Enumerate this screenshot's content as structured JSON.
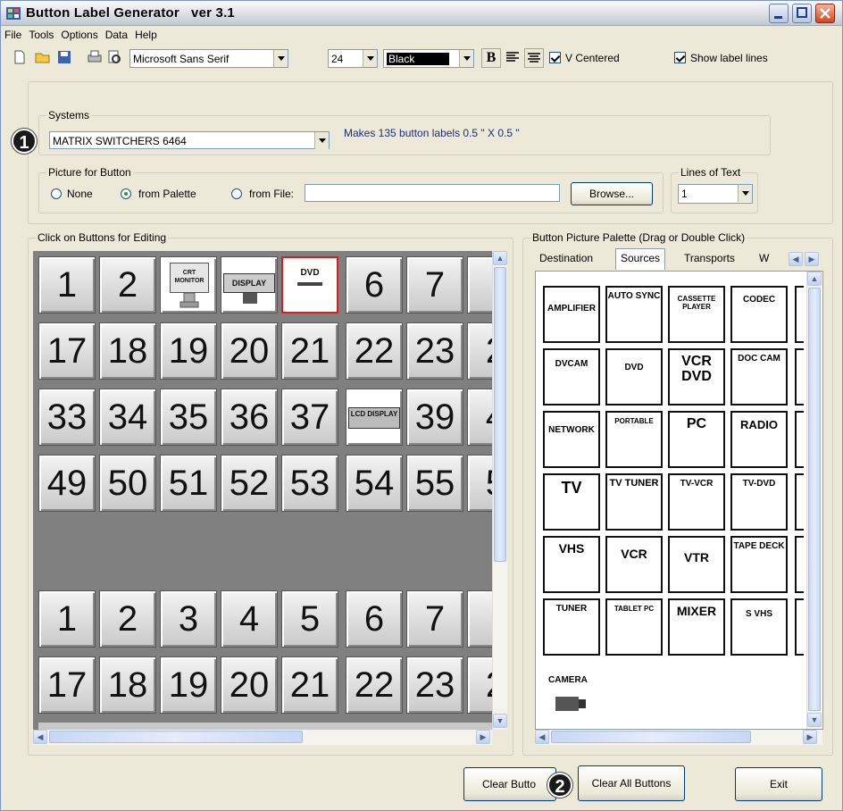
{
  "window": {
    "title": "Button Label Generator",
    "version": "ver 3.1"
  },
  "menu": [
    "File",
    "Tools",
    "Options",
    "Data",
    "Help"
  ],
  "toolbar": {
    "font": "Microsoft Sans Serif",
    "size": "24",
    "color": "Black",
    "bold": "B",
    "v_centered": "V Centered",
    "show_label_lines": "Show label lines"
  },
  "systems": {
    "label": "Systems",
    "value": "MATRIX SWITCHERS 6464",
    "info": "Makes 135 button labels 0.5 \" X 0.5 \""
  },
  "picture": {
    "label": "Picture for Button",
    "none": "None",
    "palette": "from Palette",
    "file": "from File:",
    "browse": "Browse..."
  },
  "lines": {
    "label": "Lines of Text",
    "value": "1"
  },
  "buttons_area": {
    "label": "Click on Buttons for Editing"
  },
  "grid_rows": [
    [
      "1",
      "2",
      "CRT MONITOR",
      "DISPLAY",
      "DVD",
      "6",
      "7",
      ""
    ],
    [
      "17",
      "18",
      "19",
      "20",
      "21",
      "22",
      "23",
      "2"
    ],
    [
      "33",
      "34",
      "35",
      "36",
      "37",
      "LCD DISPLAY",
      "39",
      "4"
    ],
    [
      "49",
      "50",
      "51",
      "52",
      "53",
      "54",
      "55",
      "5"
    ],
    [
      "1",
      "2",
      "3",
      "4",
      "5",
      "6",
      "7",
      ""
    ],
    [
      "17",
      "18",
      "19",
      "20",
      "21",
      "22",
      "23",
      "2"
    ]
  ],
  "palette_area": {
    "label": "Button Picture Palette (Drag or Double Click)",
    "tabs": [
      "Destination",
      "Sources",
      "Transports",
      "W"
    ],
    "active_tab": "Sources"
  },
  "palette_items": [
    [
      "AMPLIFIER",
      "AUTO SYNC",
      "CASSETTE PLAYER",
      "CODEC"
    ],
    [
      "DVCAM",
      "DVD",
      "VCR DVD",
      "DOC CAM"
    ],
    [
      "NETWORK",
      "PORTABLE",
      "PC",
      "RADIO"
    ],
    [
      "TV",
      "TV TUNER",
      "TV-VCR",
      "TV-DVD"
    ],
    [
      "VHS",
      "VCR",
      "VTR",
      "TAPE DECK"
    ],
    [
      "TUNER",
      "TABLET PC",
      "MIXER",
      "S VHS"
    ],
    [
      "CAMERA"
    ]
  ],
  "footer": {
    "clear_button": "Clear Butto",
    "clear_all": "Clear All Buttons",
    "exit": "Exit"
  },
  "callouts": {
    "one": "1",
    "two": "2"
  }
}
